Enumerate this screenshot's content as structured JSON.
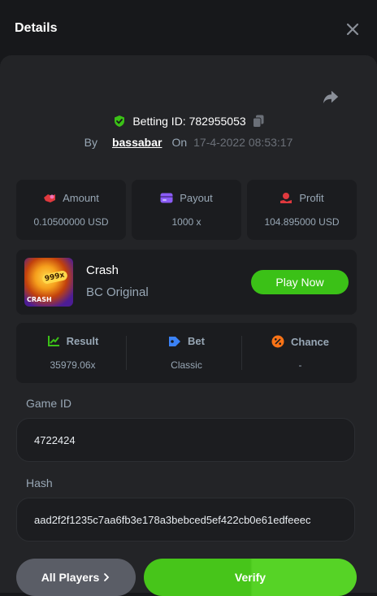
{
  "header": {
    "title": "Details"
  },
  "bet": {
    "id_label": "Betting ID: 782955053",
    "by_label": "By",
    "user": "bassabar",
    "on_label": "On",
    "date": "17-4-2022 08:53:17"
  },
  "stats": {
    "amount": {
      "label": "Amount",
      "value": "0.10500000 USD"
    },
    "payout": {
      "label": "Payout",
      "value": "1000 x"
    },
    "profit": {
      "label": "Profit",
      "value": "104.895000 USD"
    }
  },
  "game": {
    "name": "Crash",
    "subtitle": "BC Original",
    "thumb_multiplier": "999x",
    "thumb_tag": "CRASH",
    "play_label": "Play Now"
  },
  "result": {
    "result": {
      "label": "Result",
      "value": "35979.06x"
    },
    "bet": {
      "label": "Bet",
      "value": "Classic"
    },
    "chance": {
      "label": "Chance",
      "value": "-"
    }
  },
  "fields": {
    "game_id": {
      "label": "Game ID",
      "value": "4722424"
    },
    "hash": {
      "label": "Hash",
      "value": "aad2f2f1235c7aa6fb3e178a3bebced5ef422cb0e61edfeeec"
    }
  },
  "actions": {
    "all_players": "All Players",
    "verify": "Verify"
  },
  "colors": {
    "accent_green": "#3bc117",
    "icon_red": "#e0393e",
    "icon_purple": "#8b5cf6",
    "icon_blue": "#3b82f6",
    "icon_orange": "#f97316"
  },
  "icons": [
    "close-icon",
    "share-icon",
    "shield-check-icon",
    "copy-icon",
    "amount-icon",
    "payout-icon",
    "profit-icon",
    "result-icon",
    "bet-icon",
    "chance-icon",
    "chevron-right-icon"
  ]
}
